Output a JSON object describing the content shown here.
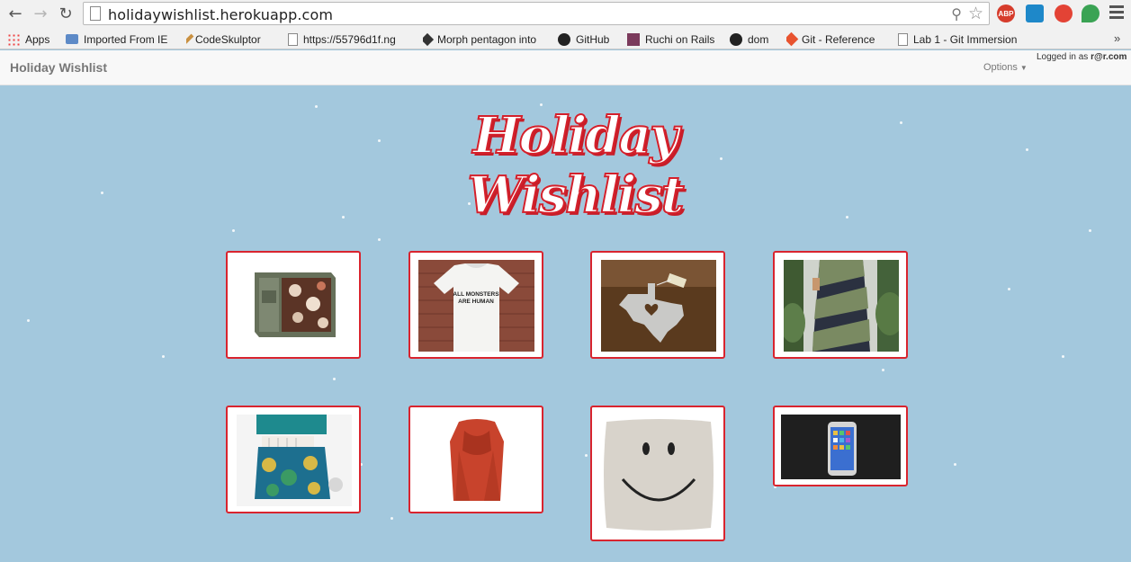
{
  "browser": {
    "url": "holidaywishlist.herokuapp.com",
    "bookmarks": [
      {
        "label": "Apps",
        "icon": "apps-grid-icon"
      },
      {
        "label": "Imported From IE",
        "icon": "folder-icon"
      },
      {
        "label": "CodeSkulptor",
        "icon": "tool-icon"
      },
      {
        "label": "https://55796d1f.ng",
        "icon": "page-icon"
      },
      {
        "label": "Morph pentagon into",
        "icon": "codepen-icon"
      },
      {
        "label": "GitHub",
        "icon": "github-icon"
      },
      {
        "label": "Ruchi on Rails",
        "icon": "ruchi-icon"
      },
      {
        "label": "dom",
        "icon": "github-icon"
      },
      {
        "label": "Git - Reference",
        "icon": "git-icon"
      },
      {
        "label": "Lab 1 - Git Immersion",
        "icon": "page-icon"
      }
    ],
    "more_label": "»",
    "extensions": {
      "abp_label": "ABP"
    }
  },
  "navbar": {
    "brand": "Holiday Wishlist",
    "options_label": "Options",
    "logged_in_prefix": "Logged in as ",
    "logged_in_user": "r@r.com"
  },
  "page": {
    "title": "Holiday Wishlist",
    "items": [
      {
        "name": "Wall organizer shelf",
        "icon": "shelf-image"
      },
      {
        "name": "All monsters are human t-shirt",
        "icon": "tshirt-image",
        "print": "ALL MONSTERS\nARE HUMAN"
      },
      {
        "name": "Texas heart ornament",
        "icon": "texas-ornament-image"
      },
      {
        "name": "Striped maxi dress",
        "icon": "dress-image"
      },
      {
        "name": "Patterned tote bag",
        "icon": "tote-bag-image"
      },
      {
        "name": "Red scarf",
        "icon": "scarf-image"
      },
      {
        "name": "Smiley pillow",
        "icon": "smiley-pillow-image"
      },
      {
        "name": "iPhone",
        "icon": "iphone-image"
      }
    ]
  },
  "colors": {
    "background": "#a3c8dd",
    "card_border": "#d9242e",
    "title_stroke": "#d4202b",
    "navbar_bg": "#f8f8f8"
  }
}
